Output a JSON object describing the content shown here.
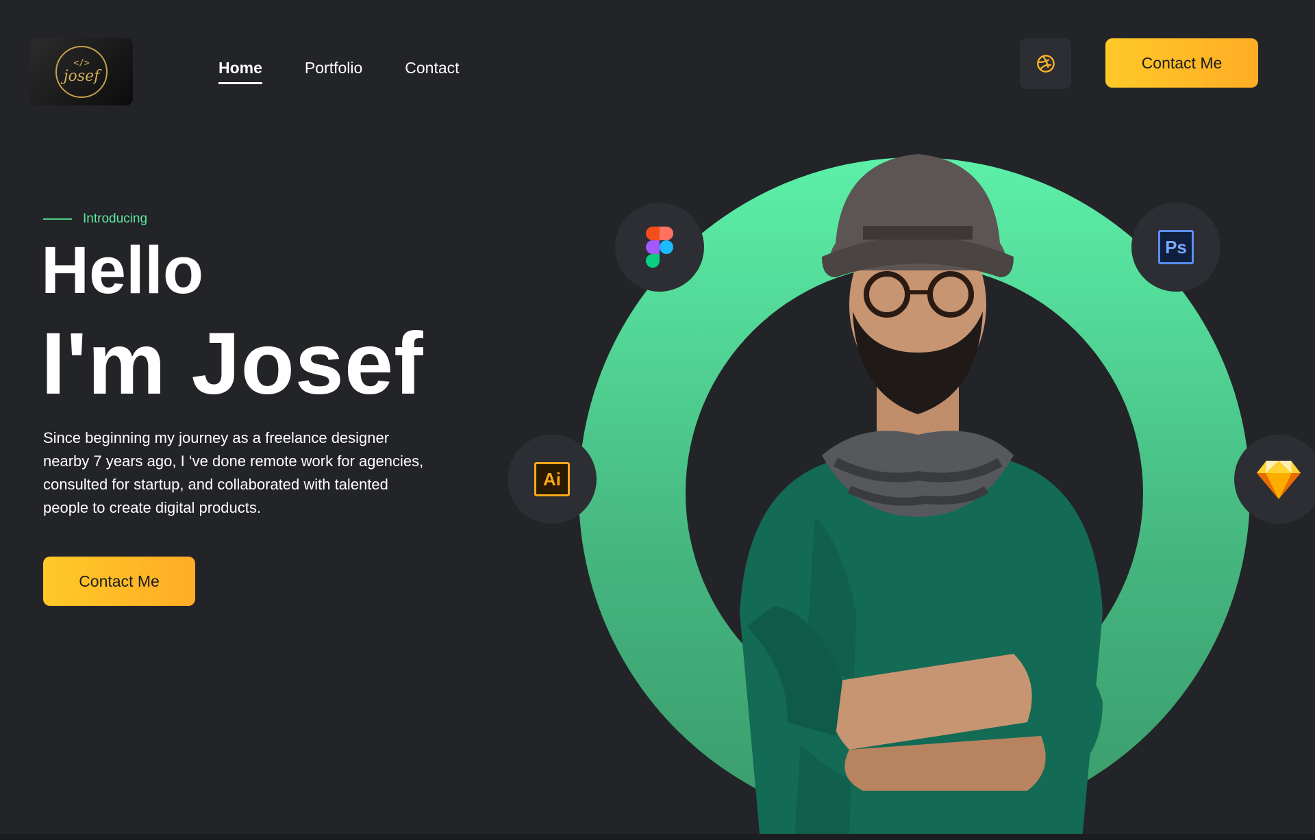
{
  "brand": {
    "logo_code": "</>",
    "logo_text": "josef"
  },
  "nav": {
    "items": [
      {
        "label": "Home",
        "active": true
      },
      {
        "label": "Portfolio",
        "active": false
      },
      {
        "label": "Contact",
        "active": false
      }
    ]
  },
  "header": {
    "cta_label": "Contact Me",
    "social_icon": "dribbble-icon"
  },
  "hero": {
    "intro": "Introducing",
    "greeting": "Hello",
    "name": "I'm Josef",
    "bio": "Since beginning my journey as a freelance designer nearby 7 years ago, I ‘ve done remote work for agencies, consulted for startup, and collaborated with talented people to create digital products.",
    "cta_label": "Contact Me"
  },
  "tools": {
    "figma": "figma-icon",
    "photoshop": "Ps",
    "illustrator": "Ai",
    "sketch": "sketch-icon"
  },
  "colors": {
    "background": "#232428",
    "accent_green": "#5ee8a0",
    "accent_yellow": "#ffc928",
    "badge": "#2d2e33"
  }
}
